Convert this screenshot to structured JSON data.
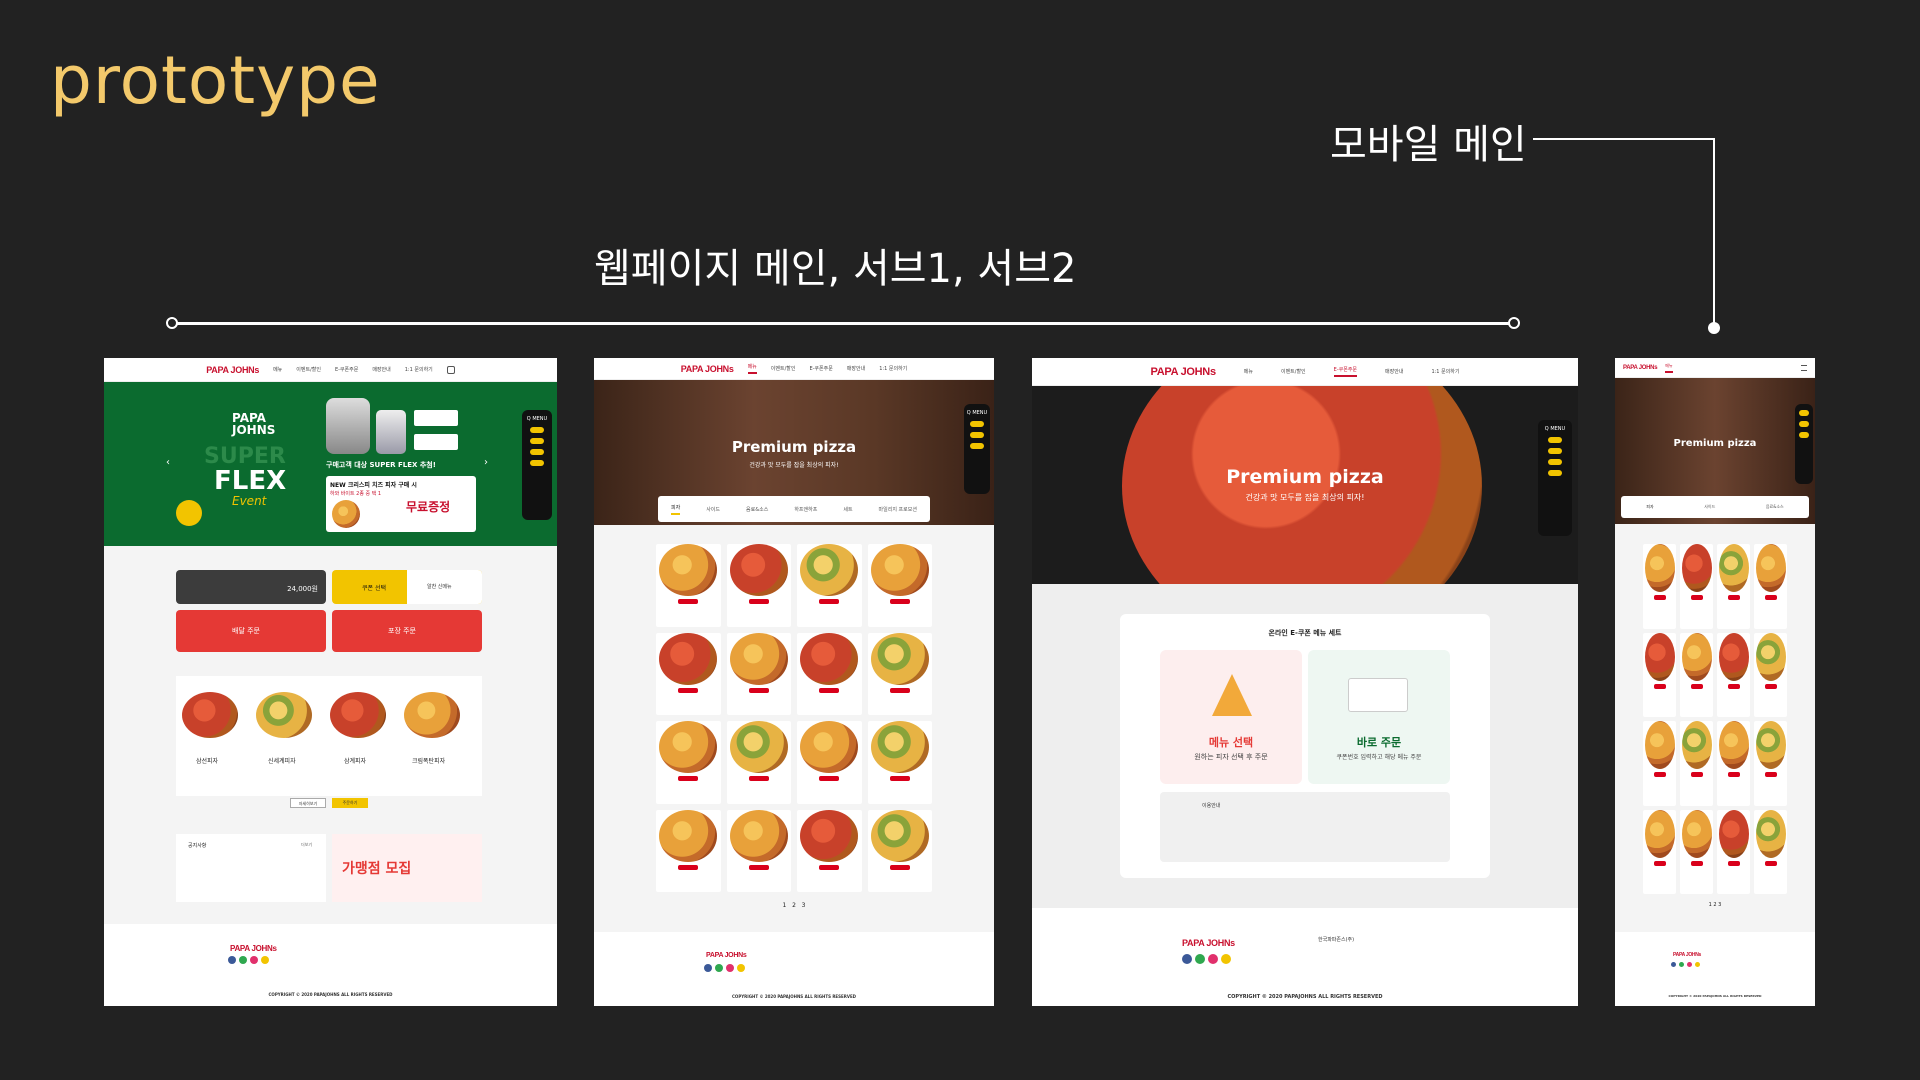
{
  "title": "prototype",
  "labels": {
    "web": "웹페이지 메인, 서브1, 서브2",
    "mobile": "모바일 메인"
  },
  "colors": {
    "accent": "#f3c96b",
    "brand_red": "#c8102e",
    "brand_green": "#0b6b2f",
    "yellow": "#f2c400"
  },
  "main_page": {
    "logo": "PAPA JOHNs",
    "nav": [
      "메뉴",
      "이벤트/할인",
      "E-쿠폰주문",
      "매장안내",
      "1:1 문의하기"
    ],
    "banner": {
      "brand": "PAPA JOHNS",
      "line1": "SUPER",
      "line2": "FLEX",
      "line3": "Event",
      "promo1": "구매고객 대상 SUPER FLEX 추첨!",
      "promo2": "NEW 크리스피 치즈 피자 구매 시",
      "promo3": "하와 바이트 2종 중 택 1",
      "free": "무료증정"
    },
    "order_price": "24,000원",
    "coupon_label": "쿠폰 선택",
    "new_label": "알찬 신메뉴",
    "delivery": "배달 주문",
    "pickup": "포장 주문",
    "pizzas": [
      "삼선피자",
      "신세계피자",
      "삼계피자",
      "크림폭탄피자"
    ],
    "more_btn": "자세히보기",
    "order_btn": "주문하기",
    "notice_title": "공지사항",
    "notice_more": "더보기",
    "recruit": "가맹점 모집",
    "copyright": "COPYRIGHT © 2020 PAPAJOHNS ALL RIGHTS RESERVED"
  },
  "sub1": {
    "hero_title": "Premium pizza",
    "hero_sub": "건강과 맛 모두를 잡을 최상의 피자!",
    "tabs": [
      "피자",
      "사이드",
      "음료&소스",
      "하프앤하프",
      "세트",
      "마일리지 프로모션"
    ],
    "pages": [
      "1",
      "2",
      "3"
    ],
    "copyright": "COPYRIGHT © 2020 PAPAJOHNS ALL RIGHTS RESERVED"
  },
  "sub2": {
    "hero_title": "Premium pizza",
    "hero_sub": "건강과 맛 모두를 잡을 최상의 피자!",
    "section_title": "온라인 E-쿠폰 메뉴 세트",
    "option1_title": "메뉴 선택",
    "option1_desc": "원하는 피자 선택 후 주문",
    "option2_title": "바로 주문",
    "option2_desc": "쿠폰번호 입력하고 해당 메뉴 주문",
    "notice_title": "이용안내",
    "company": "한국파파존스(주)",
    "copyright": "COPYRIGHT © 2020 PAPAJOHNS ALL RIGHTS RESERVED"
  },
  "mobile": {
    "hero_title": "Premium pizza",
    "qmenu": "Q MENU",
    "pages": "1 2 3",
    "copyright": "COPYRIGHT © 2020 PAPAJOHNS ALL RIGHTS RESERVED"
  }
}
